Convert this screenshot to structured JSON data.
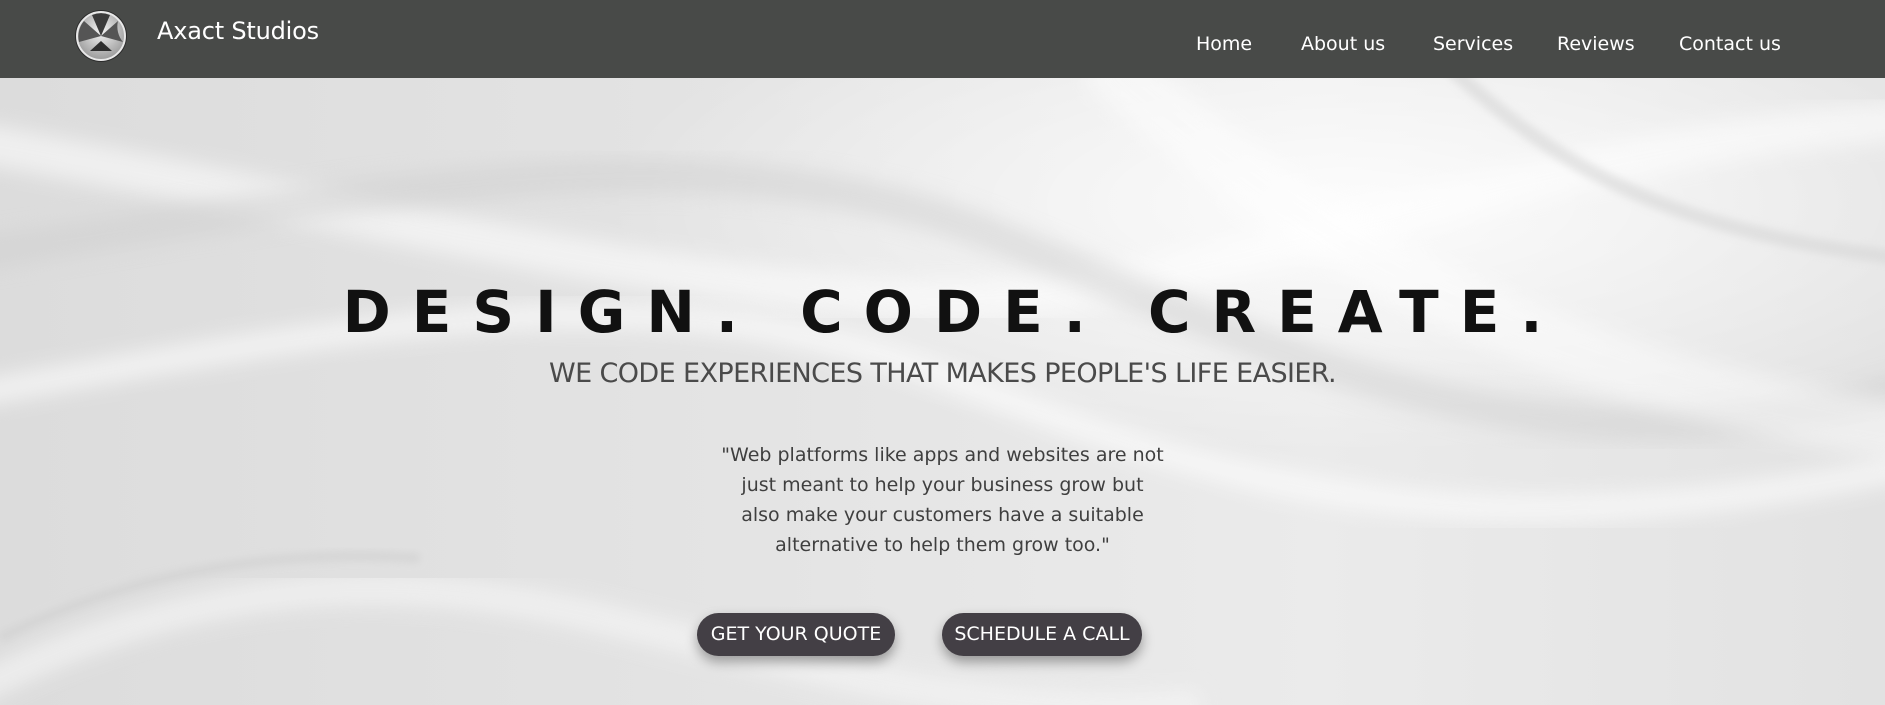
{
  "brand": {
    "name": "Axact Studios",
    "logo_icon": "tri-segment-circle-logo-icon"
  },
  "nav": {
    "items": [
      "Home",
      "About us",
      "Services",
      "Reviews",
      "Contact us"
    ]
  },
  "hero": {
    "headline": "DESIGN. CODE. CREATE.",
    "subheadline": "WE CODE EXPERIENCES THAT MAKES PEOPLE'S LIFE EASIER.",
    "quote_lines": [
      "\"Web platforms like apps and websites are not",
      "just meant to help your business grow but",
      "also make your customers have a suitable",
      "alternative to help them grow too.\""
    ],
    "buttons": {
      "quote": "GET YOUR QUOTE",
      "call": "SCHEDULE A CALL"
    }
  },
  "colors": {
    "navbar": "#484a48",
    "button": "#433f45",
    "headline": "#111111",
    "background": "#e6e6e6"
  }
}
